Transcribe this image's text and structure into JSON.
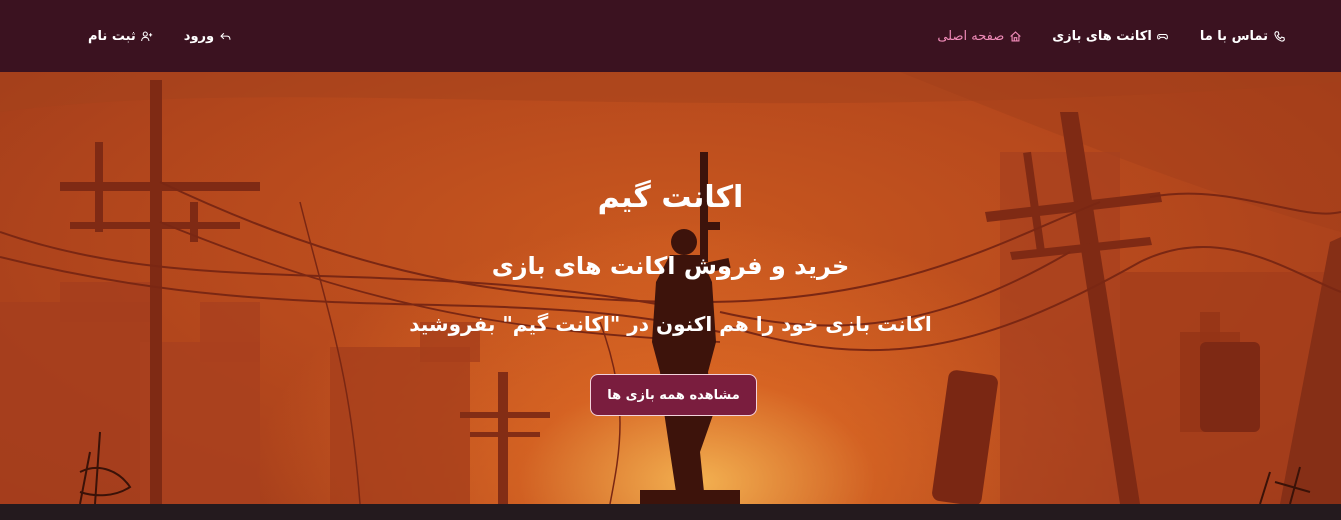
{
  "nav": {
    "home_label": "صفحه اصلی",
    "accounts_label": "اکانت های بازی",
    "contact_label": "تماس با ما",
    "register_label": "ثبت نام",
    "login_label": "ورود"
  },
  "hero": {
    "title": "اکانت گیم",
    "subtitle": "خرید و فروش اکانت های بازی",
    "description": "اکانت بازی خود را هم اکنون در \"اکانت گیم\" بفروشید",
    "button_label": "مشاهده همه بازی ها"
  },
  "colors": {
    "navbar_bg": "#3b1220",
    "active_link": "#f08bb8",
    "button_bg": "#7a1d3e",
    "hero_orange": "#c9581f"
  },
  "icons": {
    "home": "home-icon",
    "accounts": "gamepad-icon",
    "contact": "phone-icon",
    "register": "user-plus-icon",
    "login": "login-arrow-icon"
  }
}
